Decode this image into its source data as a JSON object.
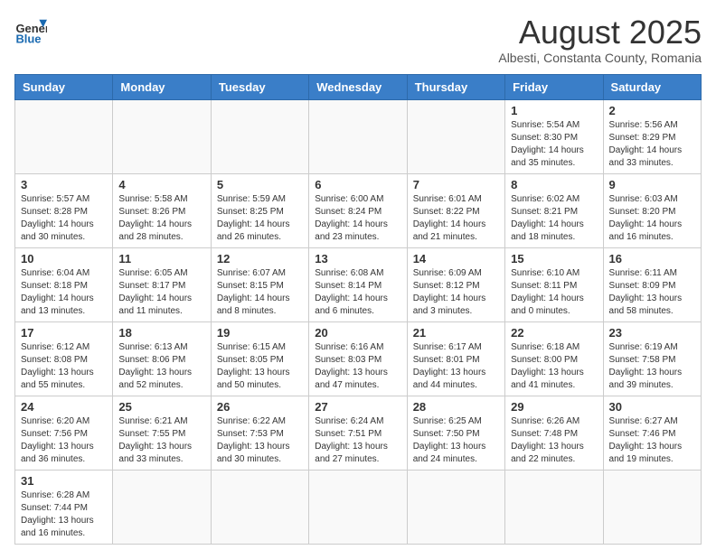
{
  "logo": {
    "text_general": "General",
    "text_blue": "Blue"
  },
  "title": "August 2025",
  "subtitle": "Albesti, Constanta County, Romania",
  "days_of_week": [
    "Sunday",
    "Monday",
    "Tuesday",
    "Wednesday",
    "Thursday",
    "Friday",
    "Saturday"
  ],
  "weeks": [
    [
      {
        "day": "",
        "info": ""
      },
      {
        "day": "",
        "info": ""
      },
      {
        "day": "",
        "info": ""
      },
      {
        "day": "",
        "info": ""
      },
      {
        "day": "",
        "info": ""
      },
      {
        "day": "1",
        "info": "Sunrise: 5:54 AM\nSunset: 8:30 PM\nDaylight: 14 hours and 35 minutes."
      },
      {
        "day": "2",
        "info": "Sunrise: 5:56 AM\nSunset: 8:29 PM\nDaylight: 14 hours and 33 minutes."
      }
    ],
    [
      {
        "day": "3",
        "info": "Sunrise: 5:57 AM\nSunset: 8:28 PM\nDaylight: 14 hours and 30 minutes."
      },
      {
        "day": "4",
        "info": "Sunrise: 5:58 AM\nSunset: 8:26 PM\nDaylight: 14 hours and 28 minutes."
      },
      {
        "day": "5",
        "info": "Sunrise: 5:59 AM\nSunset: 8:25 PM\nDaylight: 14 hours and 26 minutes."
      },
      {
        "day": "6",
        "info": "Sunrise: 6:00 AM\nSunset: 8:24 PM\nDaylight: 14 hours and 23 minutes."
      },
      {
        "day": "7",
        "info": "Sunrise: 6:01 AM\nSunset: 8:22 PM\nDaylight: 14 hours and 21 minutes."
      },
      {
        "day": "8",
        "info": "Sunrise: 6:02 AM\nSunset: 8:21 PM\nDaylight: 14 hours and 18 minutes."
      },
      {
        "day": "9",
        "info": "Sunrise: 6:03 AM\nSunset: 8:20 PM\nDaylight: 14 hours and 16 minutes."
      }
    ],
    [
      {
        "day": "10",
        "info": "Sunrise: 6:04 AM\nSunset: 8:18 PM\nDaylight: 14 hours and 13 minutes."
      },
      {
        "day": "11",
        "info": "Sunrise: 6:05 AM\nSunset: 8:17 PM\nDaylight: 14 hours and 11 minutes."
      },
      {
        "day": "12",
        "info": "Sunrise: 6:07 AM\nSunset: 8:15 PM\nDaylight: 14 hours and 8 minutes."
      },
      {
        "day": "13",
        "info": "Sunrise: 6:08 AM\nSunset: 8:14 PM\nDaylight: 14 hours and 6 minutes."
      },
      {
        "day": "14",
        "info": "Sunrise: 6:09 AM\nSunset: 8:12 PM\nDaylight: 14 hours and 3 minutes."
      },
      {
        "day": "15",
        "info": "Sunrise: 6:10 AM\nSunset: 8:11 PM\nDaylight: 14 hours and 0 minutes."
      },
      {
        "day": "16",
        "info": "Sunrise: 6:11 AM\nSunset: 8:09 PM\nDaylight: 13 hours and 58 minutes."
      }
    ],
    [
      {
        "day": "17",
        "info": "Sunrise: 6:12 AM\nSunset: 8:08 PM\nDaylight: 13 hours and 55 minutes."
      },
      {
        "day": "18",
        "info": "Sunrise: 6:13 AM\nSunset: 8:06 PM\nDaylight: 13 hours and 52 minutes."
      },
      {
        "day": "19",
        "info": "Sunrise: 6:15 AM\nSunset: 8:05 PM\nDaylight: 13 hours and 50 minutes."
      },
      {
        "day": "20",
        "info": "Sunrise: 6:16 AM\nSunset: 8:03 PM\nDaylight: 13 hours and 47 minutes."
      },
      {
        "day": "21",
        "info": "Sunrise: 6:17 AM\nSunset: 8:01 PM\nDaylight: 13 hours and 44 minutes."
      },
      {
        "day": "22",
        "info": "Sunrise: 6:18 AM\nSunset: 8:00 PM\nDaylight: 13 hours and 41 minutes."
      },
      {
        "day": "23",
        "info": "Sunrise: 6:19 AM\nSunset: 7:58 PM\nDaylight: 13 hours and 39 minutes."
      }
    ],
    [
      {
        "day": "24",
        "info": "Sunrise: 6:20 AM\nSunset: 7:56 PM\nDaylight: 13 hours and 36 minutes."
      },
      {
        "day": "25",
        "info": "Sunrise: 6:21 AM\nSunset: 7:55 PM\nDaylight: 13 hours and 33 minutes."
      },
      {
        "day": "26",
        "info": "Sunrise: 6:22 AM\nSunset: 7:53 PM\nDaylight: 13 hours and 30 minutes."
      },
      {
        "day": "27",
        "info": "Sunrise: 6:24 AM\nSunset: 7:51 PM\nDaylight: 13 hours and 27 minutes."
      },
      {
        "day": "28",
        "info": "Sunrise: 6:25 AM\nSunset: 7:50 PM\nDaylight: 13 hours and 24 minutes."
      },
      {
        "day": "29",
        "info": "Sunrise: 6:26 AM\nSunset: 7:48 PM\nDaylight: 13 hours and 22 minutes."
      },
      {
        "day": "30",
        "info": "Sunrise: 6:27 AM\nSunset: 7:46 PM\nDaylight: 13 hours and 19 minutes."
      }
    ],
    [
      {
        "day": "31",
        "info": "Sunrise: 6:28 AM\nSunset: 7:44 PM\nDaylight: 13 hours and 16 minutes."
      },
      {
        "day": "",
        "info": ""
      },
      {
        "day": "",
        "info": ""
      },
      {
        "day": "",
        "info": ""
      },
      {
        "day": "",
        "info": ""
      },
      {
        "day": "",
        "info": ""
      },
      {
        "day": "",
        "info": ""
      }
    ]
  ]
}
